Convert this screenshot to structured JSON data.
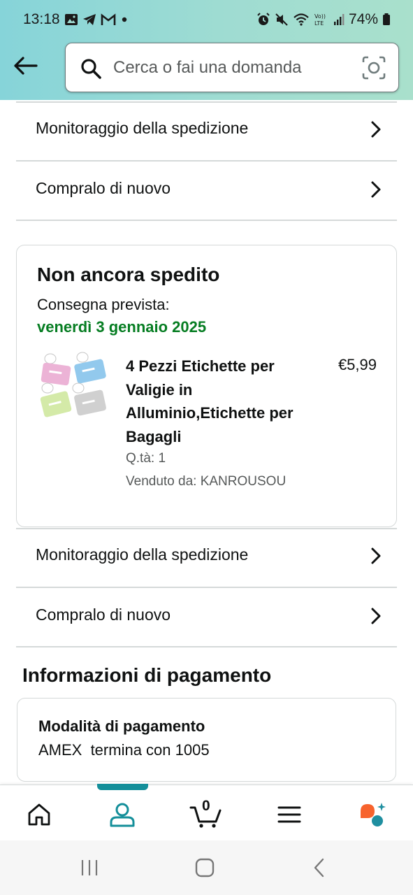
{
  "status_bar": {
    "time": "13:18",
    "battery": "74%",
    "icons": [
      "gallery-icon",
      "telegram-icon",
      "gmail-icon",
      "dot-icon",
      "alarm-icon",
      "mute-icon",
      "wifi-icon",
      "volte-icon",
      "signal-icon",
      "battery-icon"
    ]
  },
  "header": {
    "search_placeholder": "Cerca o fai una domanda"
  },
  "rows_top": [
    {
      "label": "Monitoraggio della spedizione"
    },
    {
      "label": "Compralo di nuovo"
    }
  ],
  "shipment": {
    "status_title": "Non ancora spedito",
    "eta_label": "Consegna prevista:",
    "eta_date": "venerdì 3 gennaio 2025",
    "item": {
      "name": "4 Pezzi Etichette per Valigie in Alluminio,Etichette per Bagagli",
      "price": "€5,99",
      "quantity": "Q.tà: 1",
      "seller": "Venduto da: KANROUSOU"
    }
  },
  "rows_bottom": [
    {
      "label": "Monitoraggio della spedizione"
    },
    {
      "label": "Compralo di nuovo"
    }
  ],
  "payment": {
    "section_title": "Informazioni di pagamento",
    "method_title": "Modalità di pagamento",
    "method_value": "AMEX  termina con 1005"
  },
  "bottom_nav": {
    "cart_count": "0",
    "items": [
      "home-icon",
      "account-icon",
      "cart-icon",
      "menu-icon",
      "assistant-icon"
    ],
    "active": "account-icon"
  },
  "colors": {
    "header_gradient_start": "#86d4d9",
    "header_gradient_end": "#a9e0cc",
    "eta_green": "#067d22",
    "nav_active": "#148f9a",
    "assistant_orange": "#f7632d",
    "assistant_teal": "#1f8fa0"
  }
}
